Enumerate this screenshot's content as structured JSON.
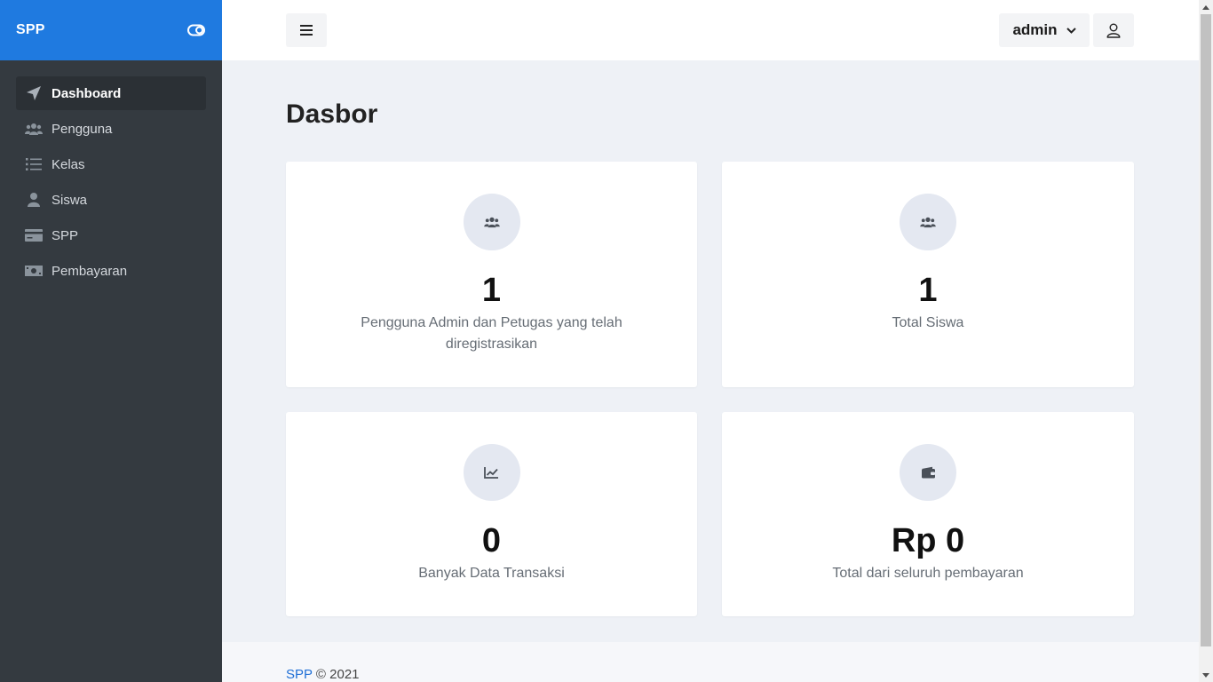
{
  "brand": {
    "title": "SPP"
  },
  "sidebar": {
    "items": [
      {
        "label": "Dashboard",
        "icon": "paper-plane-icon",
        "active": true
      },
      {
        "label": "Pengguna",
        "icon": "users-icon"
      },
      {
        "label": "Kelas",
        "icon": "list-icon"
      },
      {
        "label": "Siswa",
        "icon": "user-icon"
      },
      {
        "label": "SPP",
        "icon": "card-icon"
      },
      {
        "label": "Pembayaran",
        "icon": "money-icon"
      }
    ]
  },
  "topbar": {
    "user_label": "admin"
  },
  "main": {
    "title": "Dasbor",
    "cards": [
      {
        "value": "1",
        "label": "Pengguna Admin dan Petugas yang telah diregistrasikan",
        "icon": "users-icon"
      },
      {
        "value": "1",
        "label": "Total Siswa",
        "icon": "users-icon"
      },
      {
        "value": "0",
        "label": "Banyak Data Transaksi",
        "icon": "chart-line-icon"
      },
      {
        "value": "Rp 0",
        "label": "Total dari seluruh pembayaran",
        "icon": "wallet-icon"
      }
    ]
  },
  "footer": {
    "brand": "SPP",
    "text": "© 2021"
  },
  "colors": {
    "accent": "#1f7ae0",
    "sidebar": "#343a40",
    "background": "#eef1f6"
  }
}
